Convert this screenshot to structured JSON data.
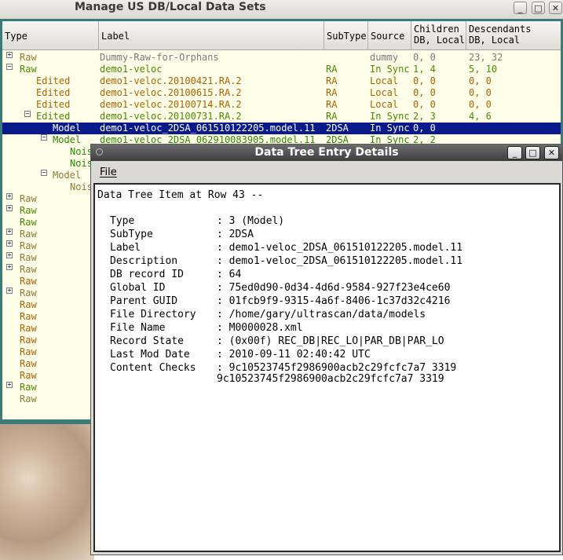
{
  "main_window": {
    "title": "Manage US DB/Local Data Sets",
    "buttons": {
      "minimize": "_",
      "maximize": "□",
      "close": "✕"
    }
  },
  "tree": {
    "columns": {
      "type": "Type",
      "label": "Label",
      "subtype": "SubType",
      "source": "Source",
      "children_l1": "Children",
      "children_l2": "DB, Local",
      "descendants_l1": "Descendants",
      "descendants_l2": "DB, Local"
    },
    "rows": [
      {
        "type": "Raw",
        "label": "Dummy-Raw-for-Orphans",
        "subtype": "",
        "source": "dummy",
        "children": "0, 0",
        "descendants": "23, 32"
      },
      {
        "type": "Raw",
        "label": "demo1-veloc",
        "subtype": "RA",
        "source": "In Sync",
        "children": "1, 4",
        "descendants": "5, 10"
      },
      {
        "type": "Edited",
        "label": "demo1-veloc.20100421.RA.2",
        "subtype": "RA",
        "source": "Local",
        "children": "0, 0",
        "descendants": "0, 0"
      },
      {
        "type": "Edited",
        "label": "demo1-veloc.20100615.RA.2",
        "subtype": "RA",
        "source": "Local",
        "children": "0, 0",
        "descendants": "0, 0"
      },
      {
        "type": "Edited",
        "label": "demo1-veloc.20100714.RA.2",
        "subtype": "RA",
        "source": "Local",
        "children": "0, 0",
        "descendants": "0, 0"
      },
      {
        "type": "Edited",
        "label": "demo1-veloc.20100731.RA.2",
        "subtype": "RA",
        "source": "In Sync",
        "children": "2, 3",
        "descendants": "4, 6"
      },
      {
        "type": "Model",
        "label": "demo1-veloc_2DSA_061510122205.model.11",
        "subtype": "2DSA",
        "source": "In Sync",
        "children": "0, 0",
        "descendants": ""
      },
      {
        "type": "Model",
        "label": "demo1-veloc_2DSA_062910083905.model.11",
        "subtype": "2DSA",
        "source": "In Sync",
        "children": "2, 2",
        "descendants": ""
      },
      {
        "type": "Nois",
        "label": "",
        "subtype": "",
        "source": "",
        "children": "",
        "descendants": ""
      },
      {
        "type": "Nois",
        "label": "",
        "subtype": "",
        "source": "",
        "children": "",
        "descendants": ""
      },
      {
        "type": "Model",
        "label": "",
        "subtype": "",
        "source": "",
        "children": "",
        "descendants": ""
      },
      {
        "type": "Nois",
        "label": "",
        "subtype": "",
        "source": "",
        "children": "",
        "descendants": ""
      },
      {
        "type": "Raw"
      },
      {
        "type": "Raw"
      },
      {
        "type": "Raw"
      },
      {
        "type": "Raw"
      },
      {
        "type": "Raw"
      },
      {
        "type": "Raw"
      },
      {
        "type": "Raw"
      },
      {
        "type": "Raw"
      },
      {
        "type": "Raw"
      },
      {
        "type": "Raw"
      },
      {
        "type": "Raw"
      },
      {
        "type": "Raw"
      },
      {
        "type": "Raw"
      },
      {
        "type": "Raw"
      },
      {
        "type": "Raw"
      },
      {
        "type": "Raw"
      },
      {
        "type": "Raw"
      },
      {
        "type": "Raw"
      }
    ]
  },
  "dialog": {
    "title": "Data Tree Entry Details",
    "buttons": {
      "minimize": "_",
      "maximize": "□",
      "close": "✕"
    },
    "menu_file": "File",
    "heading": "Data Tree Item at Row 43 --",
    "fields": [
      {
        "key": "Type",
        "value": "3 (Model)"
      },
      {
        "key": "SubType",
        "value": "2DSA"
      },
      {
        "key": "Label",
        "value": "demo1-veloc_2DSA_061510122205.model.11"
      },
      {
        "key": "Description",
        "value": "demo1-veloc_2DSA_061510122205.model.11"
      },
      {
        "key": "DB record ID",
        "value": "64"
      },
      {
        "key": "Global ID",
        "value": "75ed0d90-0d34-4d6d-9584-927f23e4ce60"
      },
      {
        "key": "Parent GUID",
        "value": "01fcb9f9-9315-4a6f-8406-1c37d32c4216"
      },
      {
        "key": "File Directory",
        "value": "/home/gary/ultrascan/data/models"
      },
      {
        "key": "File Name",
        "value": "M0000028.xml"
      },
      {
        "key": "Record State",
        "value": "(0x00f) REC_DB|REC_LO|PAR_DB|PAR_LO"
      },
      {
        "key": "Last Mod Date",
        "value": "2010-09-11 02:40:42 UTC"
      },
      {
        "key": "Content Checks",
        "value": "9c10523745f2986900acb2c29fcfc7a7 3319"
      }
    ],
    "content_checks_line2": "9c10523745f2986900acb2c29fcfc7a7 3319"
  }
}
